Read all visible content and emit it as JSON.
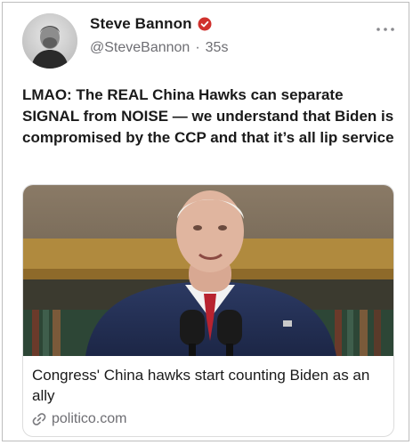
{
  "post": {
    "author": {
      "display_name": "Steve Bannon",
      "handle": "@SteveBannon",
      "separator": "·",
      "timestamp": "35s",
      "verified_color": "#d0312d"
    },
    "text": "LMAO: The REAL China Hawks can separate SIGNAL from NOISE — we understand that Biden is compromised by the CCP and that it’s all lip service",
    "link_card": {
      "title": "Congress' China hawks start counting Biden as an ally",
      "domain": "politico.com",
      "icon": "link-icon"
    },
    "more_icon": "ellipsis-icon"
  }
}
